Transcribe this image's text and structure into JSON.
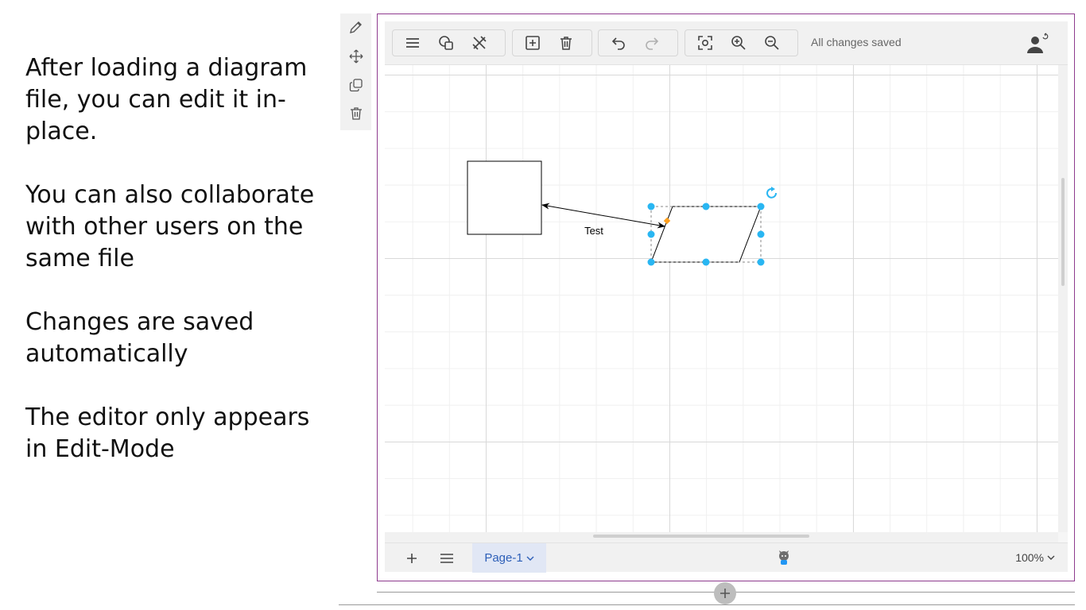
{
  "notes": [
    "After loading a diagram file, you can edit it in-place.",
    "You can also collaborate with other users on the same file",
    "Changes are saved automatically",
    "The editor only appears in Edit-Mode"
  ],
  "side_tools": [
    "pencil-icon",
    "move-icon",
    "copy-icon",
    "trash-icon"
  ],
  "toolbar": {
    "groups": [
      [
        "menu-icon",
        "shapes-icon",
        "format-icon"
      ],
      [
        "insert-icon",
        "delete-icon"
      ],
      [
        "undo-icon",
        "redo-icon"
      ],
      [
        "fit-icon",
        "zoom-in-icon",
        "zoom-out-icon"
      ]
    ],
    "status": "All changes saved"
  },
  "diagram": {
    "edge_label": "Test",
    "colors": {
      "handle": "#29b6f2",
      "anchor": "#ff9f1c",
      "stroke": "#000000"
    }
  },
  "footer": {
    "page_tab": "Page-1",
    "zoom": "100%"
  }
}
